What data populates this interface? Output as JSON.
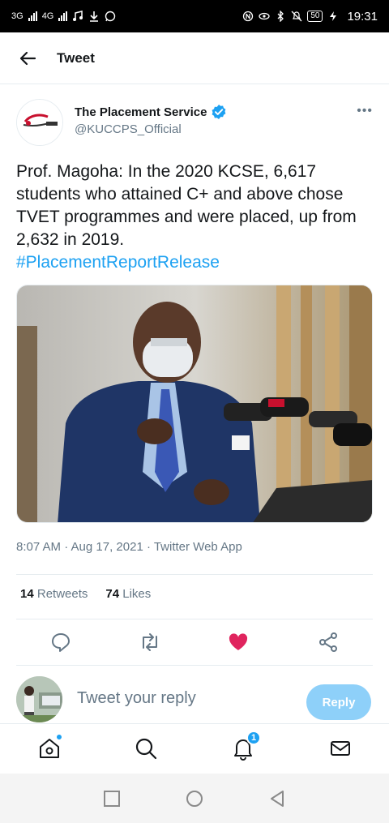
{
  "status_bar": {
    "network_left": "3G",
    "network_right": "4G",
    "battery": "50",
    "time": "19:31"
  },
  "header": {
    "title": "Tweet"
  },
  "tweet": {
    "author_name": "The Placement Service",
    "author_handle": "@KUCCPS_Official",
    "text": "Prof. Magoha: In the 2020 KCSE, 6,617 students who attained C+ and above chose TVET programmes and were placed, up from 2,632 in 2019.",
    "hashtag": "#PlacementReportRelease",
    "timestamp": "8:07 AM · Aug 17, 2021 · Twitter Web App",
    "retweets_count": "14",
    "retweets_label": "Retweets",
    "likes_count": "74",
    "likes_label": "Likes",
    "liked": true
  },
  "reply": {
    "placeholder": "Tweet your reply",
    "button_label": "Reply"
  },
  "bottom_nav": {
    "items": [
      "home-icon",
      "search-icon",
      "notifications-icon",
      "messages-icon"
    ],
    "notifications_badge": "1"
  },
  "colors": {
    "accent": "#1da1f2",
    "like": "#e0245e",
    "reply_button": "#8ed0f9",
    "muted": "#657786"
  }
}
